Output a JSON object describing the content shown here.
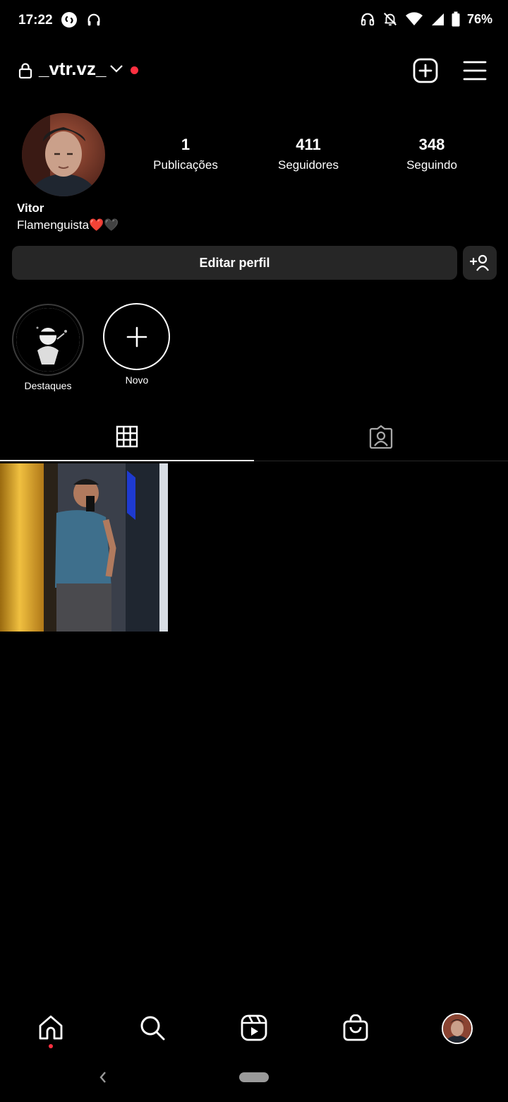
{
  "status_bar": {
    "time": "17:22",
    "battery_percent": "76%",
    "icons_left": [
      "shazam-icon",
      "headphones-icon"
    ],
    "icons_right": [
      "headset-icon",
      "notifications-off-icon",
      "wifi-icon",
      "signal-icon",
      "battery-icon"
    ]
  },
  "header": {
    "username": "_vtr.vz_",
    "private": true,
    "has_notification_dot": true,
    "accent_color": "#ff3040"
  },
  "profile": {
    "stats": [
      {
        "value": "1",
        "label": "Publicações"
      },
      {
        "value": "411",
        "label": "Seguidores"
      },
      {
        "value": "348",
        "label": "Seguindo"
      }
    ],
    "name": "Vitor",
    "bio": "Flamenguista❤️🖤",
    "edit_button_label": "Editar perfil"
  },
  "highlights": [
    {
      "label": "Destaques",
      "kind": "highlight-cover"
    },
    {
      "label": "Novo",
      "kind": "new-highlight"
    }
  ],
  "tabs": [
    {
      "name": "posts-grid",
      "icon": "grid-icon",
      "active": true
    },
    {
      "name": "tagged",
      "icon": "tagged-person-icon",
      "active": false
    }
  ],
  "posts": [
    {
      "kind": "photo",
      "description_icon": "post-photo"
    }
  ],
  "bottom_nav": [
    {
      "name": "home",
      "icon": "home-icon",
      "active": true
    },
    {
      "name": "search",
      "icon": "search-icon"
    },
    {
      "name": "reels",
      "icon": "reels-icon"
    },
    {
      "name": "shop",
      "icon": "shop-bag-icon"
    },
    {
      "name": "profile",
      "icon": "profile-avatar"
    }
  ]
}
